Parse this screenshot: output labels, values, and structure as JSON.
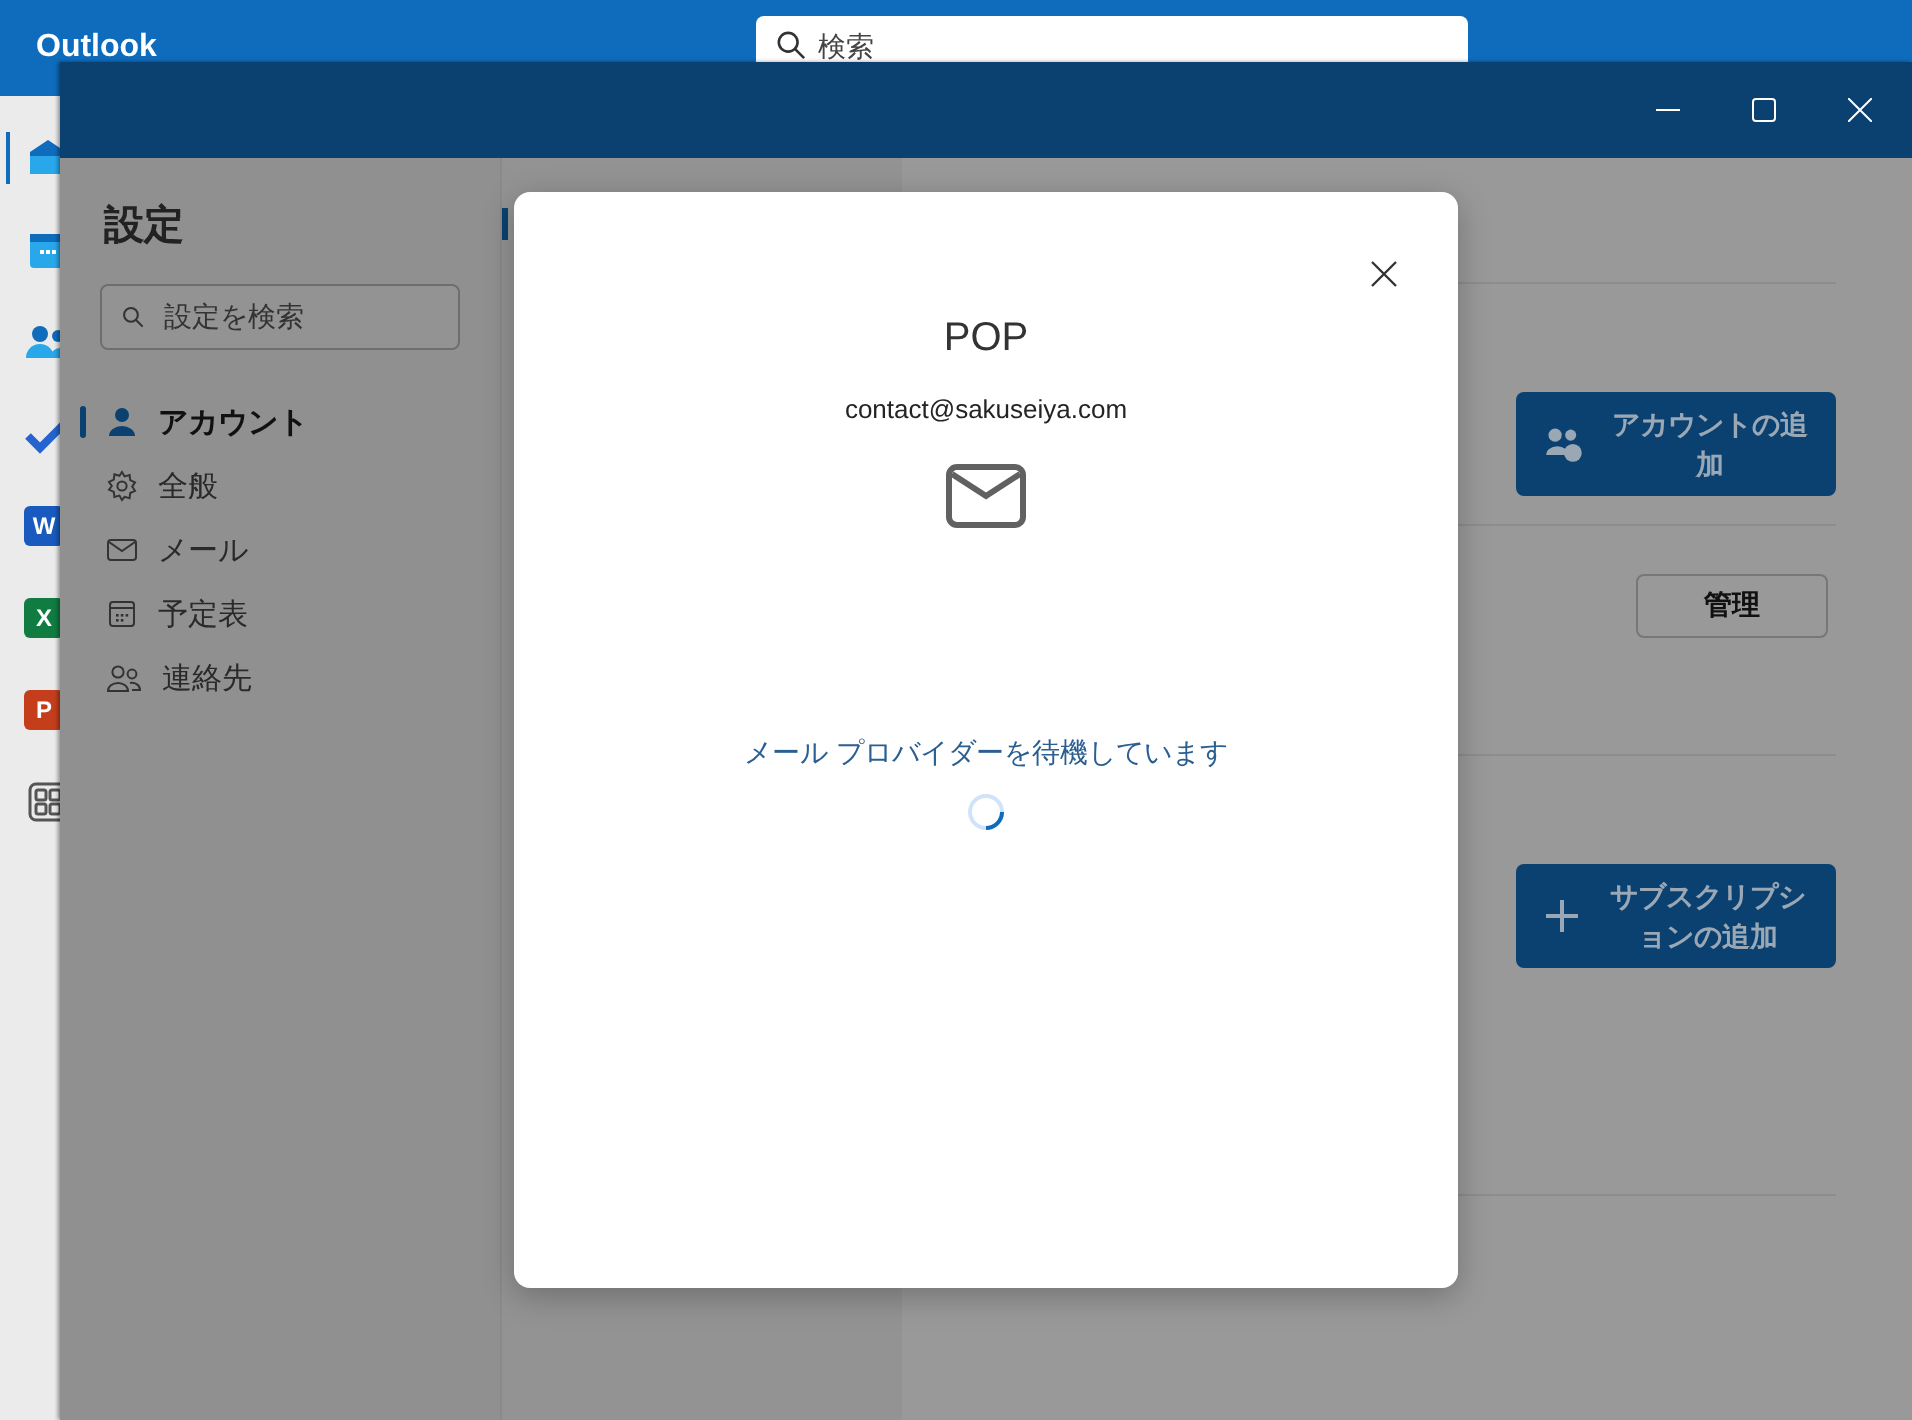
{
  "app": {
    "title": "Outlook",
    "search": {
      "placeholder": "検索"
    }
  },
  "rail": [
    {
      "kind": "mail",
      "selected": true
    },
    {
      "kind": "calendar",
      "selected": false
    },
    {
      "kind": "people",
      "selected": false
    },
    {
      "kind": "todo",
      "selected": false
    },
    {
      "kind": "word",
      "letter": "W",
      "selected": false
    },
    {
      "kind": "excel",
      "letter": "X",
      "selected": false
    },
    {
      "kind": "powerpoint",
      "letter": "P",
      "selected": false
    },
    {
      "kind": "apps",
      "selected": false
    }
  ],
  "settings": {
    "title": "設定",
    "search": {
      "placeholder": "設定を検索"
    },
    "nav": [
      {
        "kind": "person",
        "label": "アカウント",
        "selected": true
      },
      {
        "kind": "gear",
        "label": "全般",
        "selected": false
      },
      {
        "kind": "mail",
        "label": "メール",
        "selected": false
      },
      {
        "kind": "calendar",
        "label": "予定表",
        "selected": false
      },
      {
        "kind": "people",
        "label": "連絡先",
        "selected": false
      }
    ]
  },
  "content": {
    "buttons": [
      {
        "kind": "add-account",
        "label": "アカウントの追加"
      },
      {
        "kind": "manage",
        "label": "管理"
      },
      {
        "kind": "add-subscription",
        "label": "サブスクリプションの追加"
      }
    ]
  },
  "dialog": {
    "title": "POP",
    "email": "contact@sakuseiya.com",
    "status": "メール プロバイダーを待機しています"
  }
}
